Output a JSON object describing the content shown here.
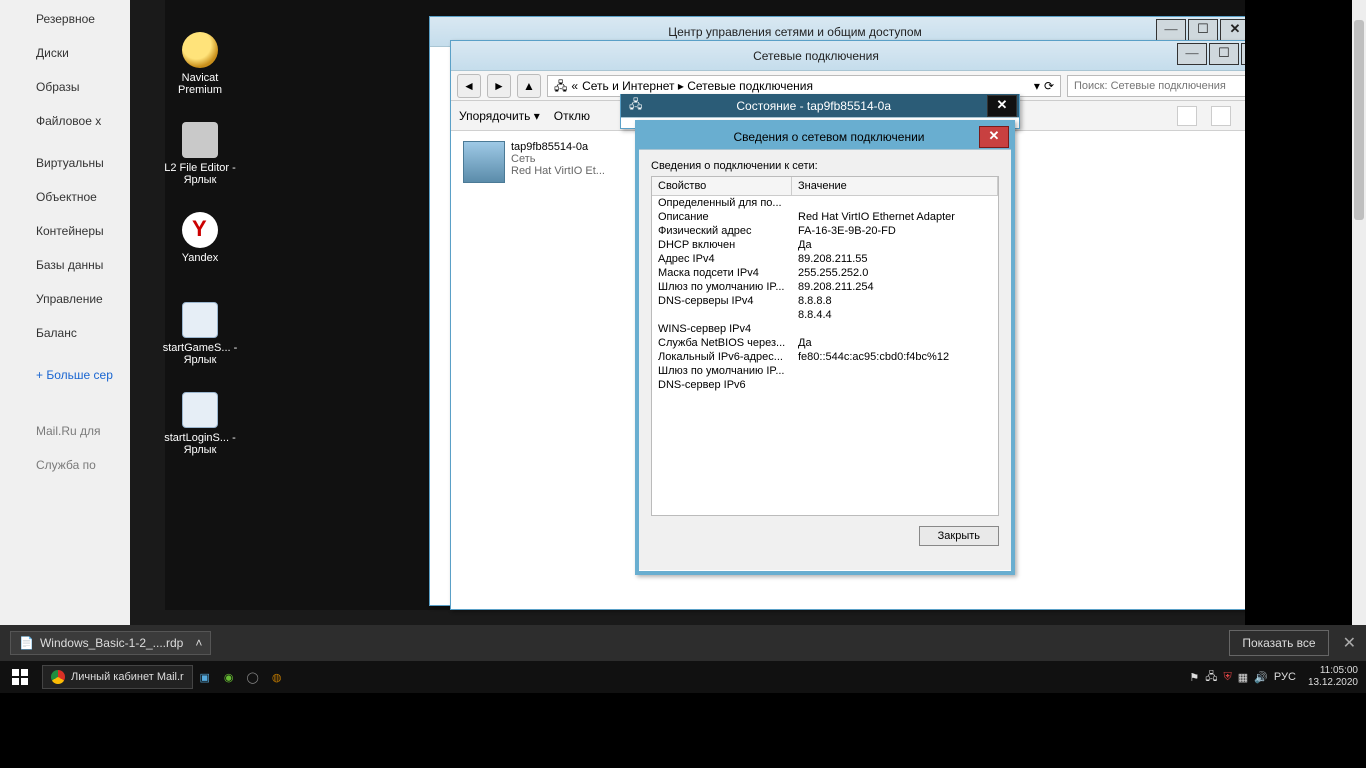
{
  "host_sidebar": {
    "items": [
      {
        "label": "Резервное"
      },
      {
        "label": "Диски"
      },
      {
        "label": "Образы"
      },
      {
        "label": "Файловое х"
      },
      {
        "label": "Виртуальны"
      },
      {
        "label": "Объектное"
      },
      {
        "label": "Контейнеры"
      },
      {
        "label": "Базы данны"
      },
      {
        "label": "Управление"
      },
      {
        "label": "Баланс"
      }
    ],
    "more": "+  Больше сер",
    "grey": [
      {
        "label": "Mail.Ru для"
      },
      {
        "label": "Служба по"
      }
    ]
  },
  "desktop_icons": [
    {
      "name": "Navicat Premium",
      "cls": "navicat"
    },
    {
      "name": "L2 File Editor - Ярлык",
      "cls": "editor"
    },
    {
      "name": "Yandex",
      "cls": "yandex"
    },
    {
      "name": "startGameS... - Ярлык",
      "cls": "sc"
    },
    {
      "name": "startLoginS... - Ярлык",
      "cls": "sc"
    }
  ],
  "parent_window": {
    "title": "Центр управления сетями и общим доступом"
  },
  "nc_window": {
    "title": "Сетевые подключения",
    "path_prefix": "«",
    "path": "Сеть и Интернет  ▸  Сетевые подключения",
    "search_placeholder": "Поиск: Сетевые подключения",
    "cmds": {
      "organise": "Упорядочить  ▾",
      "disable": "Отклю"
    },
    "adapter": {
      "name": "tap9fb85514-0a",
      "net": "Сеть",
      "drv": "Red Hat VirtIO Et..."
    }
  },
  "status_window": {
    "title": "Состояние - tap9fb85514-0a"
  },
  "details_window": {
    "title": "Сведения о сетевом подключении",
    "subtitle": "Сведения о подключении к сети:",
    "col1": "Свойство",
    "col2": "Значение",
    "rows": [
      {
        "p": "Определенный для по...",
        "v": ""
      },
      {
        "p": "Описание",
        "v": "Red Hat VirtIO Ethernet Adapter"
      },
      {
        "p": "Физический адрес",
        "v": "FA-16-3E-9B-20-FD"
      },
      {
        "p": "DHCP включен",
        "v": "Да"
      },
      {
        "p": "Адрес IPv4",
        "v": "89.208.211.55"
      },
      {
        "p": "Маска подсети IPv4",
        "v": "255.255.252.0"
      },
      {
        "p": "Шлюз по умолчанию IP...",
        "v": "89.208.211.254"
      },
      {
        "p": "DNS-серверы IPv4",
        "v": "8.8.8.8"
      },
      {
        "p": "",
        "v": "8.8.4.4"
      },
      {
        "p": "WINS-сервер IPv4",
        "v": ""
      },
      {
        "p": "Служба NetBIOS через...",
        "v": "Да"
      },
      {
        "p": "Локальный IPv6-адрес...",
        "v": "fe80::544c:ac95:cbd0:f4bc%12"
      },
      {
        "p": "Шлюз по умолчанию IP...",
        "v": ""
      },
      {
        "p": "DNS-сервер IPv6",
        "v": ""
      }
    ],
    "close_btn": "Закрыть"
  },
  "dlbar": {
    "file": "Windows_Basic-1-2_....rdp",
    "show": "Показать все"
  },
  "taskbar": {
    "app": "Личный кабинет Mail.r",
    "lang": "РУС",
    "time": "11:05:00",
    "date": "13.12.2020"
  }
}
